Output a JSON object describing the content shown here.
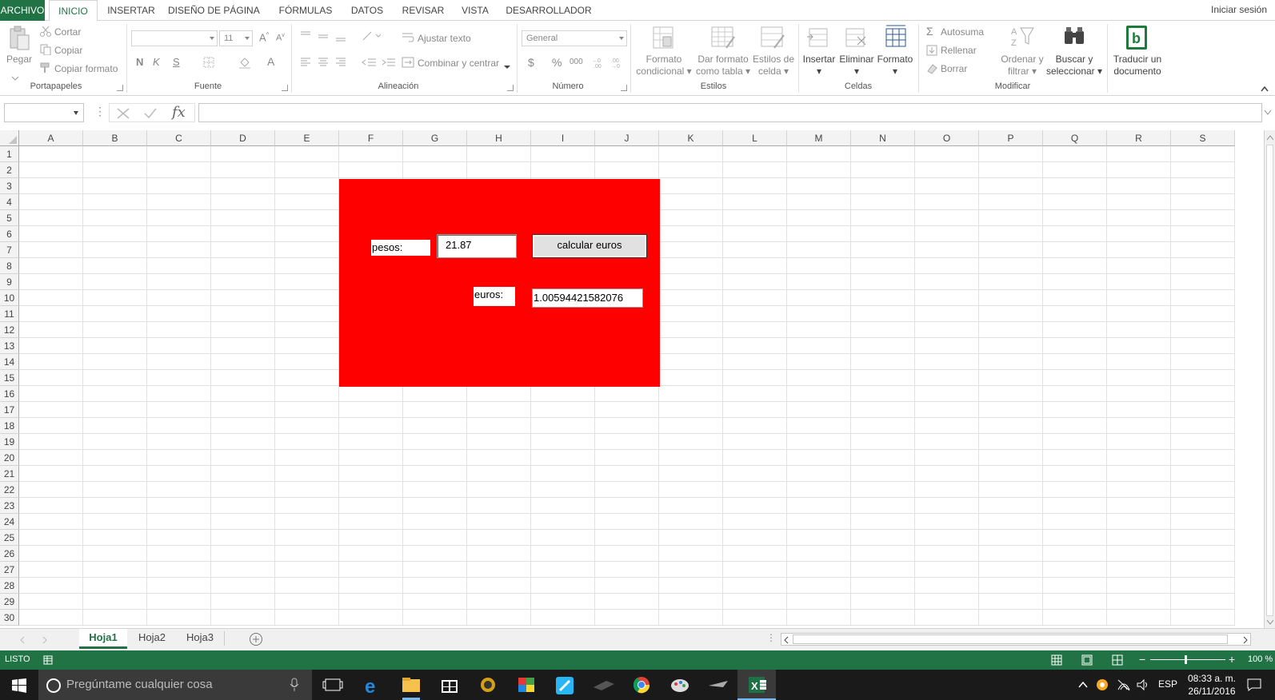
{
  "tabs": {
    "file": "ARCHIVO",
    "items": [
      "INICIO",
      "INSERTAR",
      "DISEÑO DE PÁGINA",
      "FÓRMULAS",
      "DATOS",
      "REVISAR",
      "VISTA",
      "DESARROLLADOR"
    ],
    "active": "INICIO",
    "signin": "Iniciar sesión"
  },
  "ribbon": {
    "clipboard": {
      "paste": "Pegar",
      "cut": "Cortar",
      "copy": "Copiar",
      "format_painter": "Copiar formato",
      "label": "Portapapeles"
    },
    "font": {
      "size": "11",
      "bold": "N",
      "italic": "K",
      "underline": "S",
      "label": "Fuente"
    },
    "alignment": {
      "wrap": "Ajustar texto",
      "merge": "Combinar y centrar",
      "label": "Alineación"
    },
    "number": {
      "format": "General",
      "currency": "$",
      "percent": "%",
      "thousands": "000",
      "label": "Número"
    },
    "styles": {
      "conditional_1": "Formato",
      "conditional_2": "condicional",
      "as_table_1": "Dar formato",
      "as_table_2": "como tabla",
      "cell_styles_1": "Estilos de",
      "cell_styles_2": "celda",
      "label": "Estilos"
    },
    "cells": {
      "insert": "Insertar",
      "delete": "Eliminar",
      "format": "Formato",
      "label": "Celdas"
    },
    "editing": {
      "autosum": "Autosuma",
      "fill": "Rellenar",
      "clear": "Borrar",
      "sort_1": "Ordenar y",
      "sort_2": "filtrar",
      "find_1": "Buscar y",
      "find_2": "seleccionar",
      "label": "Modificar"
    },
    "translate": {
      "line1": "Traducir un",
      "line2": "documento"
    }
  },
  "formula_bar": {
    "name_box": "",
    "fx": "fx",
    "content": ""
  },
  "columns": [
    "A",
    "B",
    "C",
    "D",
    "E",
    "F",
    "G",
    "H",
    "I",
    "J",
    "K",
    "L",
    "M",
    "N",
    "O",
    "P",
    "Q",
    "R",
    "S"
  ],
  "rows": [
    "1",
    "2",
    "3",
    "4",
    "5",
    "6",
    "7",
    "8",
    "9",
    "10",
    "11",
    "12",
    "13",
    "14",
    "15",
    "16",
    "17",
    "18",
    "19",
    "20",
    "21",
    "22",
    "23",
    "24",
    "25",
    "26",
    "27",
    "28",
    "29",
    "30"
  ],
  "form": {
    "pesos_label": "pesos:",
    "pesos_value": "21.87",
    "calc_button": "calcular euros",
    "euros_label": "euros:",
    "euros_value": "1.00594421582076",
    "background": "#ff0000"
  },
  "sheets": {
    "tabs": [
      "Hoja1",
      "Hoja2",
      "Hoja3"
    ],
    "active": "Hoja1"
  },
  "status": {
    "mode": "LISTO",
    "zoom": "100 %"
  },
  "taskbar": {
    "search_placeholder": "Pregúntame cualquier cosa",
    "language": "ESP",
    "time": "08:33 a. m.",
    "date": "26/11/2016"
  },
  "colors": {
    "excel_green": "#217346",
    "form_red": "#ff0000",
    "taskbar": "#1a1a1a"
  }
}
